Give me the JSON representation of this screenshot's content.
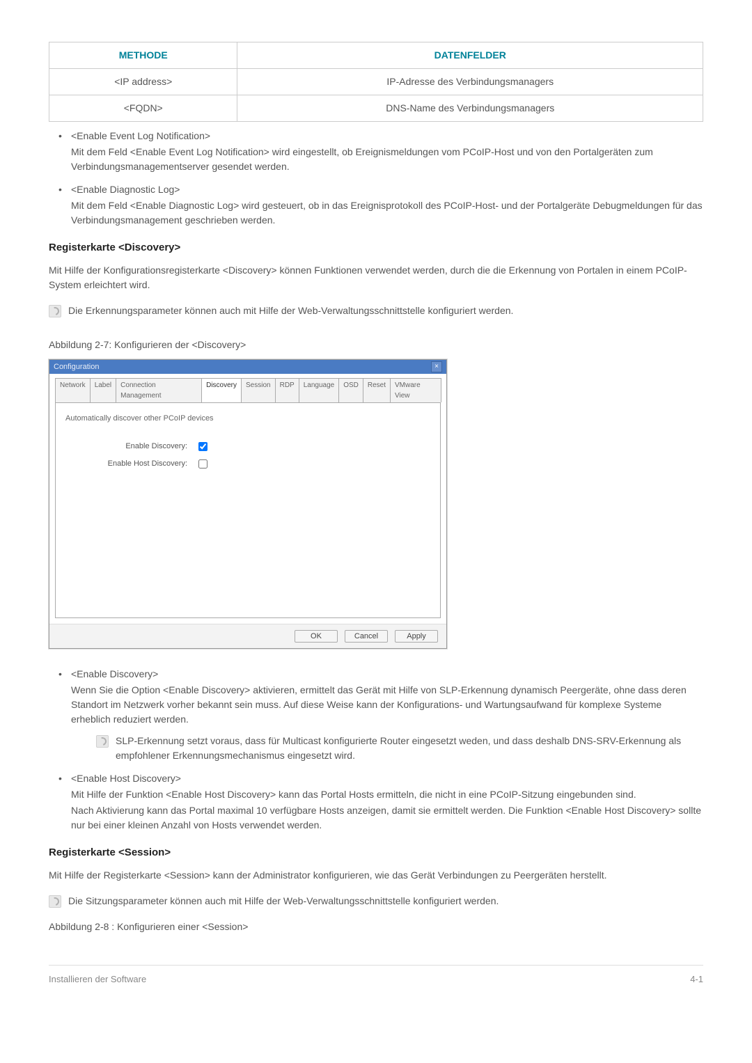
{
  "table": {
    "headers": [
      "METHODE",
      "DATENFELDER"
    ],
    "rows": [
      {
        "method": "<IP address>",
        "field": "IP-Adresse des Verbindungsmanagers"
      },
      {
        "method": "<FQDN>",
        "field": "DNS-Name des Verbindungsmanagers"
      }
    ]
  },
  "bullets_top": [
    {
      "term": "<Enable Event Log Notification>",
      "desc": "Mit dem Feld <Enable Event Log Notification> wird eingestellt, ob Ereignismeldungen vom PCoIP-Host und von den Portalgeräten zum Verbindungsmanagementserver gesendet werden."
    },
    {
      "term": "<Enable Diagnostic Log>",
      "desc": "Mit dem Feld <Enable Diagnostic Log> wird gesteuert, ob in das Ereignisprotokoll des PCoIP-Host- und der Portalgeräte Debugmeldungen für das Verbindungsmanagement geschrieben werden."
    }
  ],
  "section_discovery": {
    "heading": "Registerkarte <Discovery>",
    "intro": "Mit Hilfe der Konfigurationsregisterkarte <Discovery> können Funktionen verwendet werden, durch die die Erkennung von Portalen in einem PCoIP-System erleichtert wird.",
    "note": "Die Erkennungsparameter können auch mit Hilfe der Web-Verwaltungsschnittstelle konfiguriert werden.",
    "caption": "Abbildung 2-7: Konfigurieren der <Discovery>"
  },
  "dialog": {
    "title": "Configuration",
    "tabs": [
      "Network",
      "Label",
      "Connection Management",
      "Discovery",
      "Session",
      "RDP",
      "Language",
      "OSD",
      "Reset",
      "VMware View"
    ],
    "active_tab": "Discovery",
    "desc": "Automatically discover other PCoIP devices",
    "fields": {
      "enable_discovery_label": "Enable Discovery:",
      "enable_host_discovery_label": "Enable Host Discovery:"
    },
    "buttons": {
      "ok": "OK",
      "cancel": "Cancel",
      "apply": "Apply"
    }
  },
  "bullets_discovery": [
    {
      "term": "<Enable Discovery>",
      "desc": "Wenn Sie die Option <Enable Discovery> aktivieren, ermittelt das Gerät mit Hilfe von SLP-Erkennung dynamisch Peergeräte, ohne dass deren Standort im Netzwerk vorher bekannt sein muss. Auf diese Weise kann der Konfigurations- und Wartungsaufwand für komplexe Systeme erheblich reduziert werden.",
      "subnote": "SLP-Erkennung setzt voraus, dass für Multicast konfigurierte Router eingesetzt weden, und dass deshalb DNS-SRV-Erkennung als empfohlener Erkennungsmechanismus eingesetzt wird."
    },
    {
      "term": "<Enable Host Discovery>",
      "desc": "Mit Hilfe der Funktion <Enable Host Discovery> kann das Portal Hosts ermitteln, die nicht in eine PCoIP-Sitzung eingebunden sind.",
      "desc2": "Nach Aktivierung kann das Portal maximal 10 verfügbare Hosts anzeigen, damit sie ermittelt werden. Die Funktion <Enable Host Discovery> sollte nur bei einer kleinen Anzahl von Hosts verwendet werden."
    }
  ],
  "section_session": {
    "heading": "Registerkarte <Session>",
    "intro": "Mit Hilfe der Registerkarte <Session> kann der Administrator konfigurieren, wie das Gerät Verbindungen zu Peergeräten herstellt.",
    "note": "Die Sitzungsparameter können auch mit Hilfe der Web-Verwaltungsschnittstelle konfiguriert werden.",
    "caption": "Abbildung  2-8 : Konfigurieren einer <Session>"
  },
  "footer": {
    "left": "Installieren der Software",
    "right": "4-1"
  }
}
